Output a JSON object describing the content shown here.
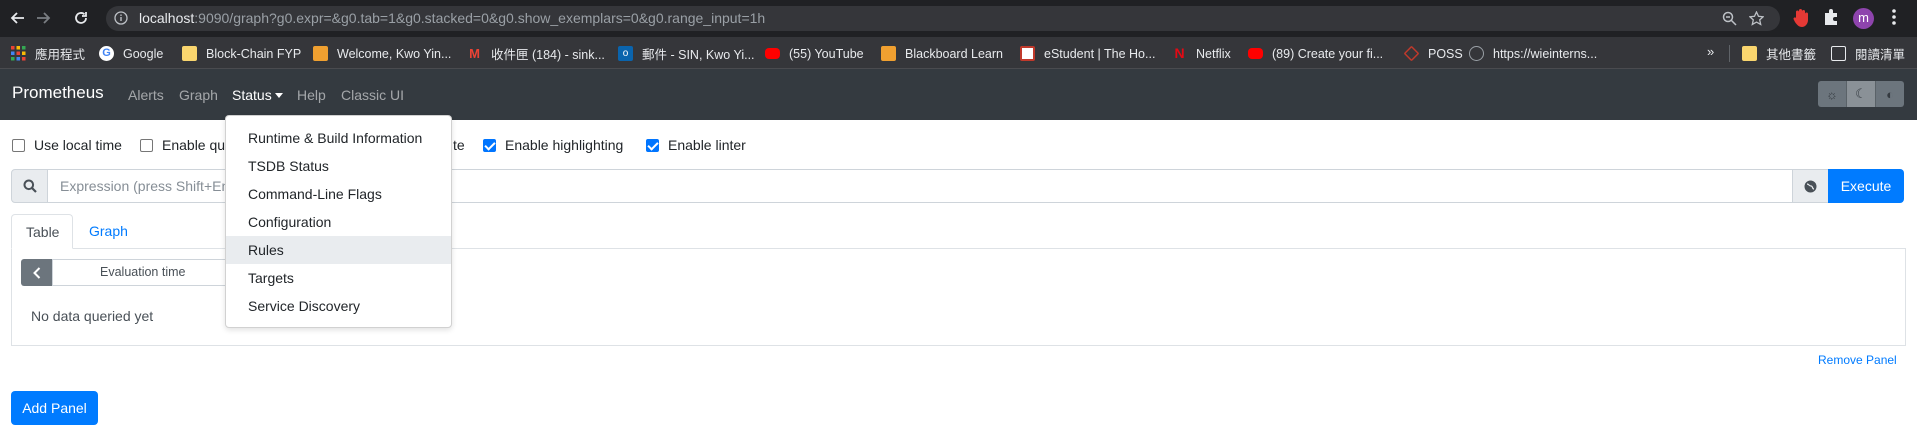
{
  "browser": {
    "url_host": "localhost",
    "url_rest": ":9090/graph?g0.expr=&g0.tab=1&g0.stacked=0&g0.show_exemplars=0&g0.range_input=1h",
    "profile_initial": "m"
  },
  "bookmarks": {
    "items": [
      {
        "label": "應用程式",
        "icon": "apps-grid-icon",
        "color": "#ea4335"
      },
      {
        "label": "Google",
        "icon": "google-icon",
        "color": "#4285f4"
      },
      {
        "label": "Block-Chain FYP",
        "icon": "folder-icon",
        "color": "#f9d56e"
      },
      {
        "label": "Welcome, Kwo Yin...",
        "icon": "orange-square-icon",
        "color": "#f0a030"
      },
      {
        "label": "收件匣 (184) - sink...",
        "icon": "gmail-icon",
        "color": "#ea4335"
      },
      {
        "label": "郵件 - SIN, Kwo Yi...",
        "icon": "outlook-icon",
        "color": "#0a64ad"
      },
      {
        "label": "(55) YouTube",
        "icon": "youtube-icon",
        "color": "#ff0000"
      },
      {
        "label": "Blackboard Learn",
        "icon": "orange-square-icon",
        "color": "#f0a030"
      },
      {
        "label": "eStudent | The Ho...",
        "icon": "estudent-icon",
        "color": "#c0392b"
      },
      {
        "label": "Netflix",
        "icon": "netflix-icon",
        "color": "#e50914"
      },
      {
        "label": "(89) Create your fi...",
        "icon": "youtube-icon",
        "color": "#ff0000"
      },
      {
        "label": "POSS",
        "icon": "diamond-icon",
        "color": "#c0392b"
      },
      {
        "label": "https://wieinterns...",
        "icon": "globe-icon",
        "color": "#9aa0a6"
      }
    ],
    "other_label": "其他書籤",
    "reading_list_label": "閱讀清單"
  },
  "navbar": {
    "brand": "Prometheus",
    "links": [
      "Alerts",
      "Graph"
    ],
    "status": "Status",
    "help": "Help",
    "classic": "Classic UI"
  },
  "options": {
    "local_time": "Use local time",
    "query_history": "Enable que",
    "autocomplete_tail": "te",
    "highlighting": "Enable highlighting",
    "linter": "Enable linter"
  },
  "expression": {
    "placeholder": "Expression (press Shift+Ente",
    "execute": "Execute"
  },
  "tabs": {
    "table": "Table",
    "graph": "Graph"
  },
  "panel": {
    "eval_time": "Evaluation time",
    "no_data": "No data queried yet",
    "remove": "Remove Panel",
    "add": "Add Panel"
  },
  "status_menu": {
    "items": [
      "Runtime & Build Information",
      "TSDB Status",
      "Command-Line Flags",
      "Configuration",
      "Rules",
      "Targets",
      "Service Discovery"
    ],
    "hovered": "Rules"
  }
}
